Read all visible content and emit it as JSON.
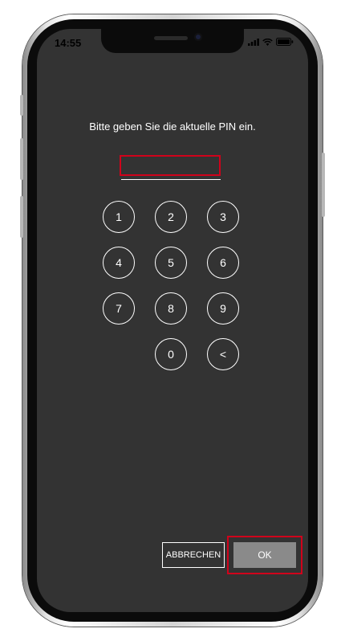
{
  "status_bar": {
    "time": "14:55",
    "icons": [
      "signal-icon",
      "wifi-icon",
      "battery-icon"
    ]
  },
  "pin_screen": {
    "prompt": "Bitte geben Sie die aktuelle PIN ein.",
    "pin_value": "",
    "keys": [
      "1",
      "2",
      "3",
      "4",
      "5",
      "6",
      "7",
      "8",
      "9",
      "0",
      "<"
    ]
  },
  "actions": {
    "cancel_label": "ABBRECHEN",
    "ok_label": "OK"
  },
  "colors": {
    "screen_background": "#333333",
    "highlight": "#d0021b",
    "ok_button": "#8a8a8a",
    "text": "#ffffff"
  }
}
